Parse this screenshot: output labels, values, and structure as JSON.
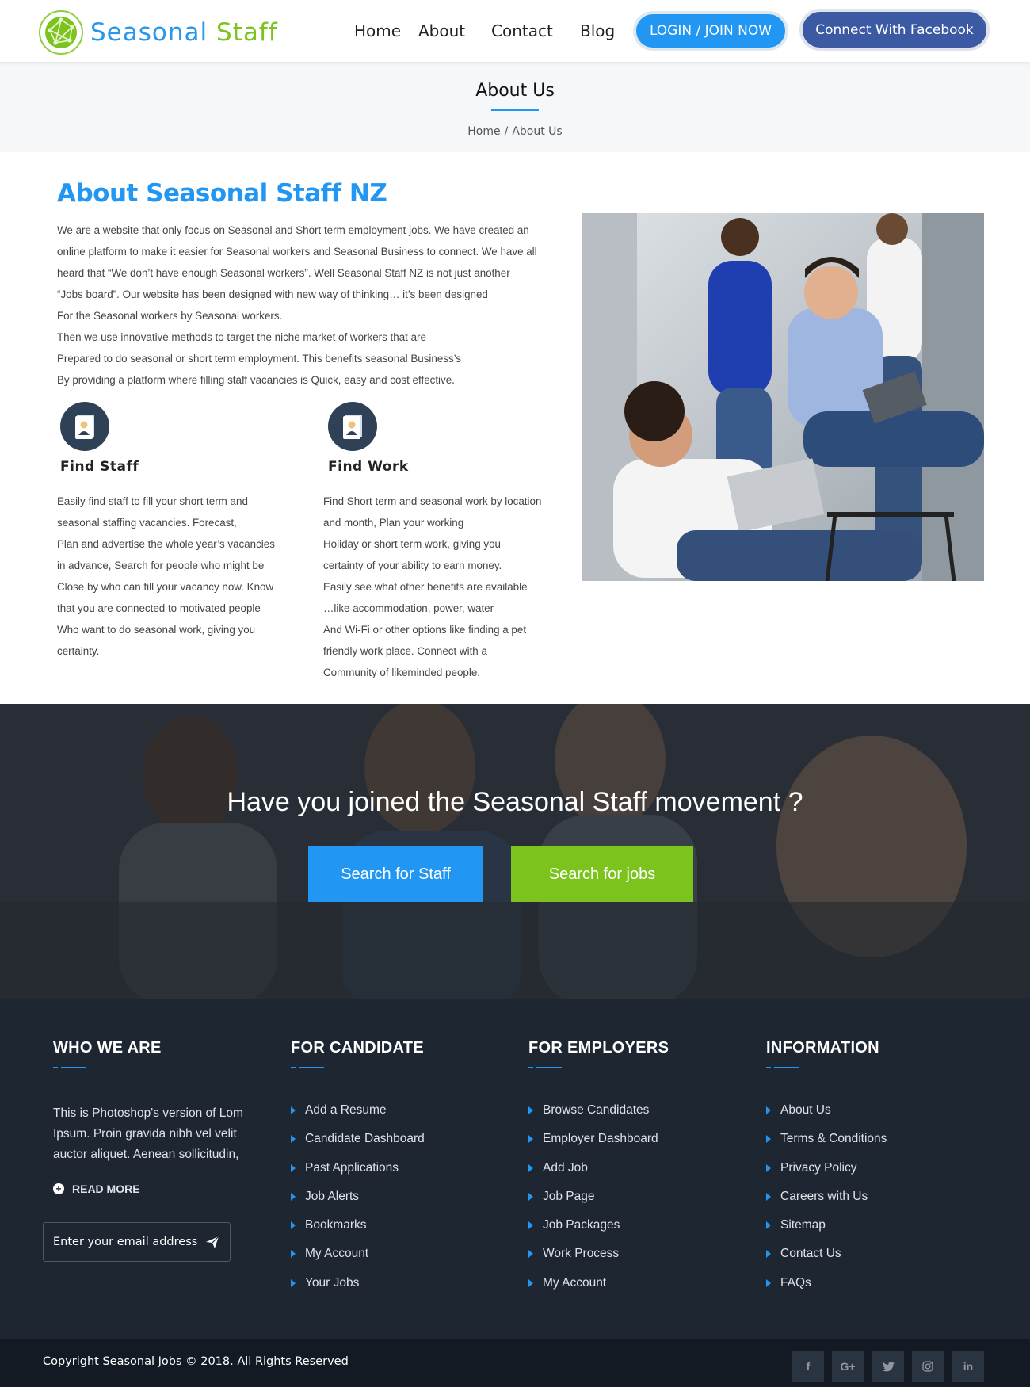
{
  "header": {
    "logo_word1": "Seasonal",
    "logo_word2": "Staff",
    "nav": [
      {
        "label": "Home"
      },
      {
        "label": "About"
      },
      {
        "label": "Contact"
      },
      {
        "label": "Blog"
      }
    ],
    "login_label": "LOGIN / JOIN NOW",
    "facebook_label": "Connect With Facebook"
  },
  "page_title": {
    "title": "About Us",
    "breadcrumb_home": "Home",
    "breadcrumb_sep": "/",
    "breadcrumb_current": "About Us"
  },
  "about": {
    "heading": "About Seasonal Staff NZ",
    "paragraph_lines": [
      "We are a website that only focus on Seasonal and Short term employment jobs. We have created an",
      "online platform to make it easier for Seasonal workers and Seasonal Business to connect.  We have all",
      "heard that “We don’t have enough Seasonal workers”.   Well Seasonal Staff NZ is not just another",
      "“Jobs board”.   Our website has been designed with new way of thinking… it’s been designed",
      "For the Seasonal workers by Seasonal workers.",
      "Then we use innovative methods to target the niche market of workers that are",
      "Prepared to do seasonal or short term employment.  This benefits seasonal Business’s",
      "By providing a platform where filling staff vacancies is Quick, easy and cost effective."
    ],
    "find_staff": {
      "title": "Find Staff",
      "lines": [
        "Easily find staff to fill your short term and",
        "seasonal staffing vacancies.   Forecast,",
        "Plan and advertise the whole year’s vacancies",
        "in advance, Search for people who might be",
        "Close by who can fill your vacancy now.  Know",
        "that you are connected to motivated people",
        "Who want to do seasonal work, giving you",
        "certainty."
      ]
    },
    "find_work": {
      "title": "Find Work",
      "lines": [
        "Find Short term and seasonal work by location",
        "and month, Plan your working",
        "Holiday or short term work, giving you",
        "certainty of your ability to earn money.",
        "Easily see what other benefits are available",
        "…like accommodation, power, water",
        "And Wi-Fi or other options like finding a pet",
        "friendly work place. Connect with a",
        "Community of likeminded people."
      ]
    }
  },
  "cta": {
    "title": "Have you joined the Seasonal Staff movement ?",
    "staff_button": "Search for Staff",
    "jobs_button": "Search for jobs"
  },
  "footer": {
    "who_we_are": {
      "heading": "WHO WE ARE",
      "lines": [
        "This is Photoshop's version of Lom",
        "Ipsum. Proin gravida nibh vel velit",
        "auctor aliquet. Aenean sollicitudin,"
      ],
      "read_more": "READ MORE",
      "email_placeholder": "Enter your email address"
    },
    "for_candidate": {
      "heading": "FOR CANDIDATE",
      "links": [
        "Add a Resume",
        "Candidate Dashboard",
        "Past Applications",
        "Job Alerts",
        "Bookmarks",
        "My Account",
        "Your Jobs"
      ]
    },
    "for_employers": {
      "heading": "FOR EMPLOYERS",
      "links": [
        "Browse Candidates",
        "Employer Dashboard",
        "Add Job",
        "Job Page",
        "Job Packages",
        "Work Process",
        "My Account"
      ]
    },
    "information": {
      "heading": "INFORMATION",
      "links": [
        "About Us",
        "Terms & Conditions",
        "Privacy Policy",
        "Careers with Us",
        "Sitemap",
        "Contact Us",
        "FAQs"
      ]
    },
    "copyright": "Copyright Seasonal Jobs © 2018. All Rights Reserved",
    "social": [
      {
        "icon": "facebook-icon",
        "glyph": "f"
      },
      {
        "icon": "google-plus-icon",
        "glyph": "G+"
      },
      {
        "icon": "twitter-icon",
        "glyph": ""
      },
      {
        "icon": "instagram-icon",
        "glyph": ""
      },
      {
        "icon": "linkedin-icon",
        "glyph": "in"
      }
    ]
  },
  "colors": {
    "primary_blue": "#2196f3",
    "brand_green": "#7cc31d",
    "facebook_blue": "#3b5aa3",
    "footer_bg": "#1e2632",
    "bottom_bar_bg": "#141a24"
  }
}
